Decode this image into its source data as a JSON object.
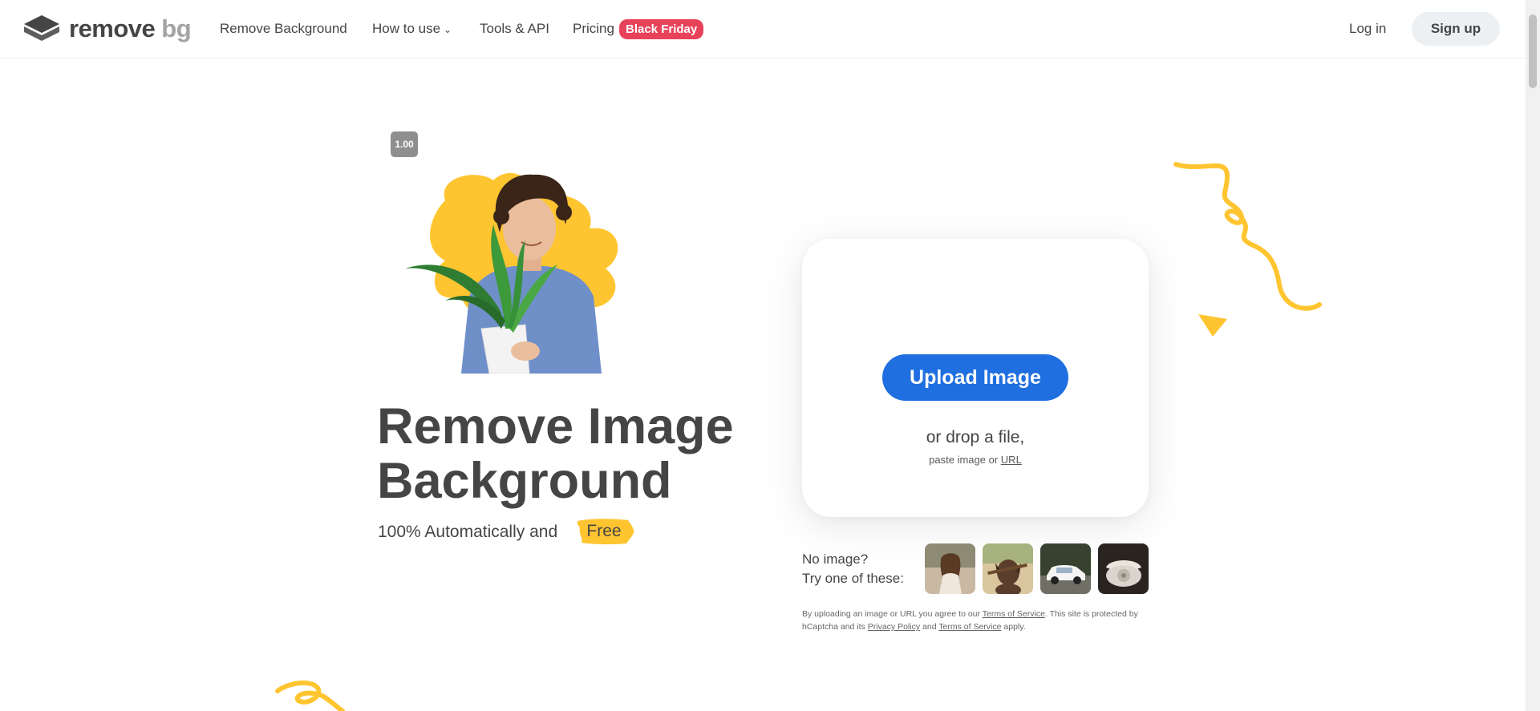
{
  "header": {
    "logo": {
      "word1": "remove",
      "word2": "bg",
      "icon": "layers-logo-icon"
    },
    "nav": [
      {
        "label": "Remove Background"
      },
      {
        "label": "How to use",
        "icon": "chevron-down-icon"
      },
      {
        "label": "Tools & API"
      },
      {
        "label": "Pricing"
      }
    ],
    "badge": "Black Friday",
    "login": "Log in",
    "signup": "Sign up"
  },
  "hero": {
    "version": "1.00",
    "title_line1": "Remove Image",
    "title_line2": "Background",
    "subtitle": "100% Automatically and",
    "highlight": "Free"
  },
  "upload": {
    "button": "Upload Image",
    "drop_text": "or drop a file,",
    "paste_text": "paste image or",
    "url_link": "URL"
  },
  "samples": {
    "line1": "No image?",
    "line2": "Try one of these:",
    "thumbnails": [
      "woman-sample",
      "dog-sample",
      "car-sample",
      "telephone-sample"
    ]
  },
  "legal": {
    "p1": "By uploading an image or URL you agree to our",
    "tos1": "Terms of Service",
    "p2": ". This site is protected by hCaptcha and its",
    "privacy": "Privacy Policy",
    "p3": "and",
    "tos2": "Terms of Service",
    "p4": "apply."
  },
  "colors": {
    "accent_blue": "#1f6fe0",
    "badge_red": "#e8425a",
    "yellow": "#ffc531",
    "text": "#454545"
  }
}
